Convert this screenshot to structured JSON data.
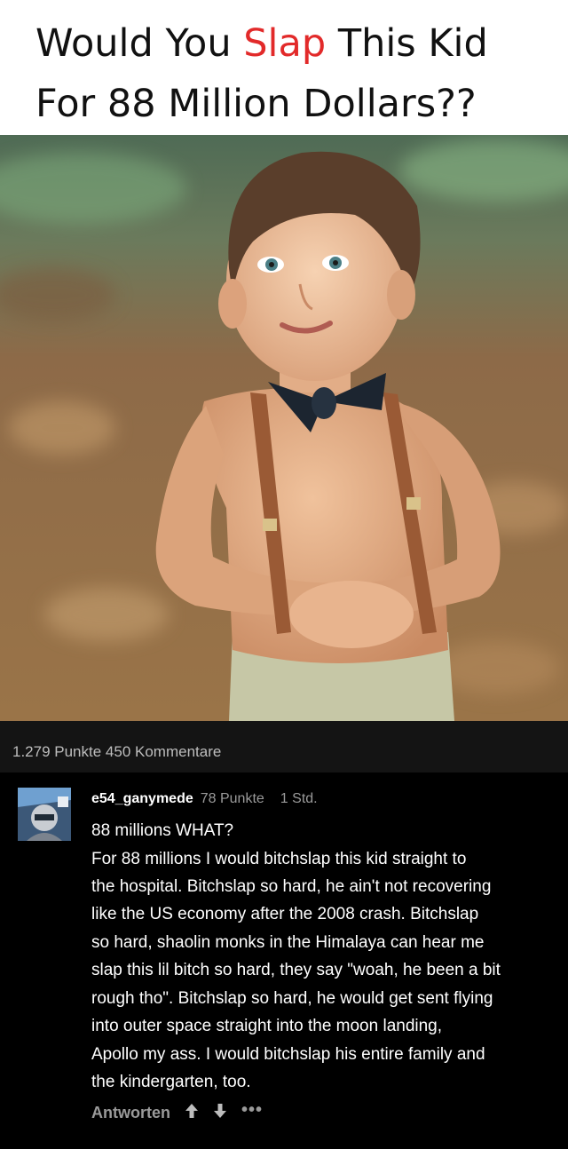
{
  "meme": {
    "title_line1_a": "Would You ",
    "title_highlight": "Slap",
    "title_line1_b": " This Kid",
    "title_line2": "For 88 Million Dollars??",
    "highlight_color": "#e22a2a"
  },
  "post": {
    "stats": "1.279 Punkte 450 Kommentare"
  },
  "comment": {
    "username": "e54_ganymede",
    "points": "78 Punkte",
    "time": "1 Std.",
    "lines": [
      "88 millions WHAT?",
      "For 88 millions I would bitchslap this kid straight to",
      "the hospital. Bitchslap so hard, he ain't not recovering",
      "like the US economy after the 2008 crash. Bitchslap",
      "so hard, shaolin monks in the Himalaya can hear me",
      "slap this lil bitch so hard, they say \"woah, he been a bit",
      "rough tho\". Bitchslap so hard, he would get sent flying",
      "into outer space straight into the moon landing,",
      "Apollo my ass. I would bitchslap his entire family and",
      "the kindergarten, too."
    ],
    "reply_label": "Antworten",
    "icons": [
      "upvote-icon",
      "downvote-icon",
      "more-options-icon"
    ],
    "more_glyph": "•••"
  }
}
